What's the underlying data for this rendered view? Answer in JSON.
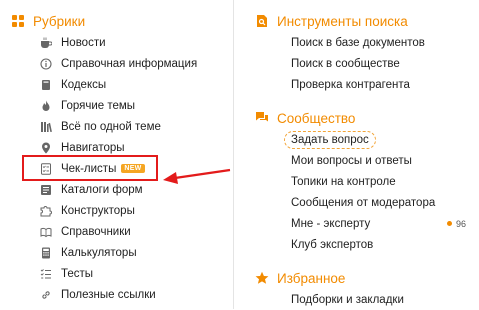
{
  "left": {
    "title": "Рубрики",
    "items": [
      {
        "label": "Новости",
        "icon": "coffee-cup-icon"
      },
      {
        "label": "Справочная информация",
        "icon": "info-circle-icon"
      },
      {
        "label": "Кодексы",
        "icon": "book-icon"
      },
      {
        "label": "Горячие темы",
        "icon": "flame-icon"
      },
      {
        "label": "Всё по одной теме",
        "icon": "library-books-icon"
      },
      {
        "label": "Навигаторы",
        "icon": "location-pin-icon"
      },
      {
        "label": "Чек-листы",
        "icon": "checklist-icon",
        "badge": "NEW"
      },
      {
        "label": "Каталоги форм",
        "icon": "form-catalog-icon"
      },
      {
        "label": "Конструкторы",
        "icon": "puzzle-icon"
      },
      {
        "label": "Справочники",
        "icon": "open-book-icon"
      },
      {
        "label": "Калькуляторы",
        "icon": "calculator-icon"
      },
      {
        "label": "Тесты",
        "icon": "list-test-icon"
      },
      {
        "label": "Полезные ссылки",
        "icon": "link-icon"
      }
    ]
  },
  "right": {
    "search": {
      "title": "Инструменты поиска",
      "items": [
        "Поиск в базе документов",
        "Поиск в сообществе",
        "Проверка контрагента"
      ]
    },
    "community": {
      "title": "Сообщество",
      "items": [
        "Задать вопрос",
        "Мои вопросы и ответы",
        "Топики на контроле",
        "Сообщения от модератора",
        "Мне - эксперту",
        "Клуб экспертов"
      ],
      "expert_count": "96"
    },
    "favorites": {
      "title": "Избранное",
      "items": [
        "Подборки и закладки"
      ]
    }
  },
  "colors": {
    "accent": "#f28b00",
    "highlight": "#e31b1b",
    "badge": "#f5a623"
  }
}
